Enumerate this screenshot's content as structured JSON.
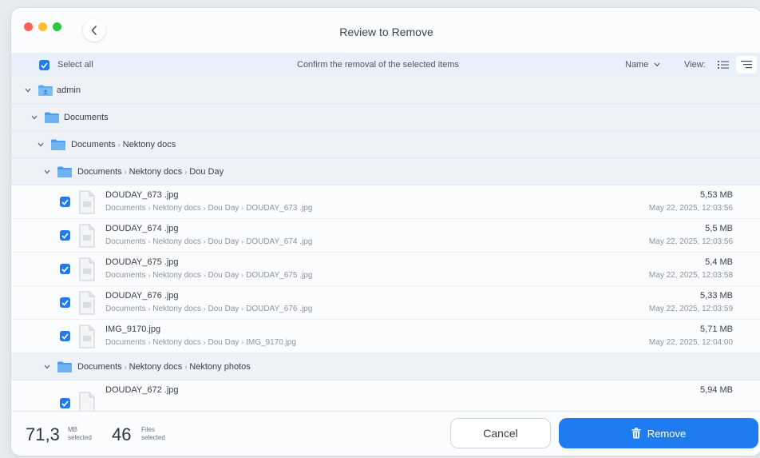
{
  "window": {
    "title": "Review to Remove"
  },
  "header": {
    "select_all_label": "Select all",
    "message": "Confirm the removal of the selected items",
    "sort_label": "Name",
    "view_label": "View:"
  },
  "tree": {
    "user_folder": "admin",
    "folders": [
      {
        "parts": [
          "Documents"
        ]
      },
      {
        "parts": [
          "Documents",
          "Nektony docs"
        ]
      },
      {
        "parts": [
          "Documents",
          "Nektony docs",
          "Dou Day"
        ]
      },
      {
        "parts": [
          "Documents",
          "Nektony docs",
          "Nektony photos"
        ]
      }
    ],
    "files": [
      {
        "name": "DOUDAY_673 .jpg",
        "path": [
          "Documents",
          "Nektony docs",
          "Dou Day",
          "DOUDAY_673 .jpg"
        ],
        "size": "5,53 MB",
        "date": "May 22, 2025, 12:03:56",
        "checked": true
      },
      {
        "name": "DOUDAY_674 .jpg",
        "path": [
          "Documents",
          "Nektony docs",
          "Dou Day",
          "DOUDAY_674 .jpg"
        ],
        "size": "5,5 MB",
        "date": "May 22, 2025, 12:03:56",
        "checked": true
      },
      {
        "name": "DOUDAY_675 .jpg",
        "path": [
          "Documents",
          "Nektony docs",
          "Dou Day",
          "DOUDAY_675 .jpg"
        ],
        "size": "5,4 MB",
        "date": "May 22, 2025, 12:03:58",
        "checked": true
      },
      {
        "name": "DOUDAY_676 .jpg",
        "path": [
          "Documents",
          "Nektony docs",
          "Dou Day",
          "DOUDAY_676 .jpg"
        ],
        "size": "5,33 MB",
        "date": "May 22, 2025, 12:03:59",
        "checked": true
      },
      {
        "name": "IMG_9170.jpg",
        "path": [
          "Documents",
          "Nektony docs",
          "Dou Day",
          "IMG_9170.jpg"
        ],
        "size": "5,71 MB",
        "date": "May 22, 2025, 12:04:00",
        "checked": true
      },
      {
        "name": "DOUDAY_672 .jpg",
        "size": "5,94 MB",
        "checked": true
      }
    ]
  },
  "footer": {
    "size_value": "71,3",
    "size_unit": "MB",
    "size_caption": "selected",
    "files_value": "46",
    "files_unit": "Files",
    "files_caption": "selected",
    "cancel_label": "Cancel",
    "remove_label": "Remove"
  },
  "colors": {
    "accent": "#1f7bf0",
    "folder": "#5aa9f0",
    "header_bg": "#e8f1fb"
  },
  "icons": [
    "chevron-left-icon",
    "checkbox-icon",
    "chevron-down-icon",
    "list-view-icon",
    "tree-view-icon",
    "folder-icon",
    "user-folder-icon",
    "image-file-icon",
    "trash-icon"
  ]
}
